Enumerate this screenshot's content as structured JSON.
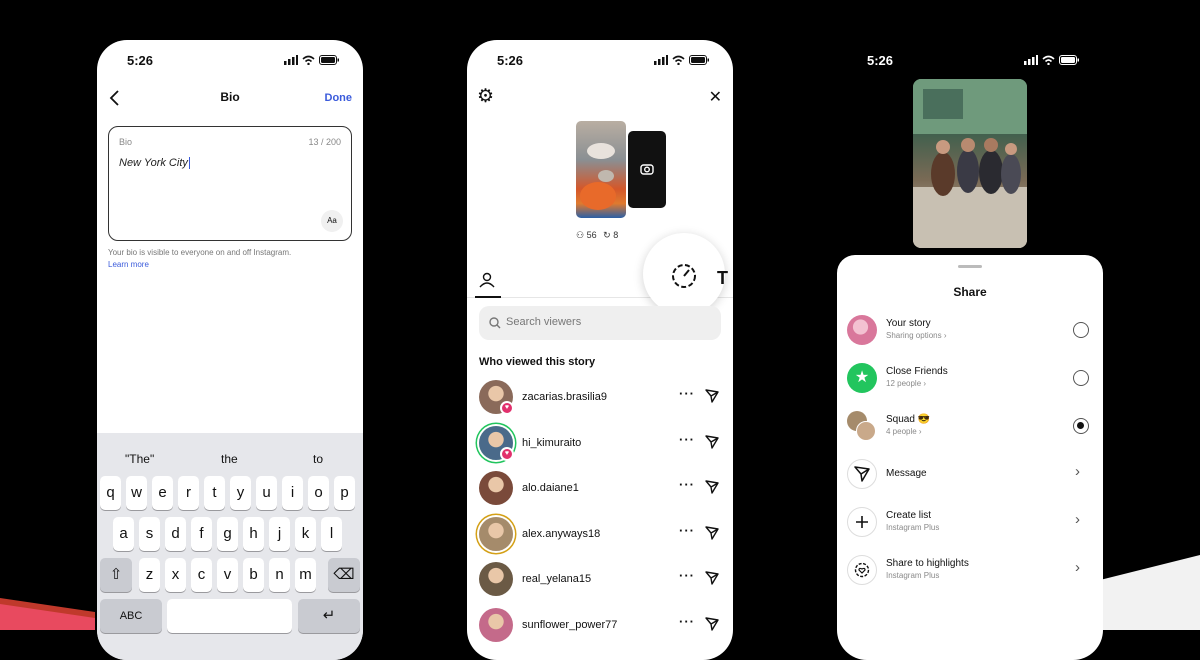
{
  "phone1": {
    "time": "5:26",
    "nav": {
      "title": "Bio",
      "done": "Done"
    },
    "bio_field": {
      "label": "Bio",
      "counter": "13 / 200",
      "value": "New York City",
      "format_button": "Aa"
    },
    "helper_text": "Your bio is visible to everyone on and off Instagram.",
    "learn_more": "Learn more",
    "keyboard": {
      "suggestions": [
        "\"The\"",
        "the",
        "to"
      ],
      "row1": [
        "q",
        "w",
        "e",
        "r",
        "t",
        "y",
        "u",
        "i",
        "o",
        "p"
      ],
      "row2": [
        "a",
        "s",
        "d",
        "f",
        "g",
        "h",
        "j",
        "k",
        "l"
      ],
      "row3": [
        "z",
        "x",
        "c",
        "v",
        "b",
        "n",
        "m"
      ],
      "abc": "ABC",
      "shift_glyph": "⇧",
      "delete_glyph": "⌫",
      "return_glyph": "↵"
    }
  },
  "phone2": {
    "time": "5:26",
    "gear_glyph": "⚙",
    "close_glyph": "✕",
    "stats": {
      "viewers": "56",
      "replays": "8"
    },
    "search_placeholder": "Search viewers",
    "section_title": "Who viewed this story",
    "viewers": [
      {
        "name": "zacarias.brasilia9",
        "liked": true,
        "color": "#8a6a5a"
      },
      {
        "name": "hi_kimuraito",
        "liked": true,
        "color": "#4a6a8a"
      },
      {
        "name": "alo.daiane1",
        "liked": false,
        "color": "#7a4a3a"
      },
      {
        "name": "alex.anyways18",
        "liked": false,
        "color": "#a58b6b"
      },
      {
        "name": "real_yelana15",
        "liked": false,
        "color": "#6b5a45"
      },
      {
        "name": "sunflower_power77",
        "liked": false,
        "color": "#c46a8a"
      }
    ]
  },
  "phone3": {
    "time": "5:26",
    "sheet_title": "Share",
    "rows": [
      {
        "title": "Your story",
        "subtitle": "Sharing options ›",
        "control": "radio",
        "selected": false,
        "color": "#d9779b"
      },
      {
        "title": "Close Friends",
        "subtitle": "12 people ›",
        "control": "radio",
        "selected": false,
        "color": "#22c55e"
      },
      {
        "title": "Squad 😎",
        "subtitle": "4 people ›",
        "control": "radio",
        "selected": true,
        "color": "#a58b6b"
      },
      {
        "title": "Message",
        "subtitle": "",
        "control": "chevron",
        "selected": false,
        "color": "#ffffff"
      },
      {
        "title": "Create list",
        "subtitle": "Instagram Plus",
        "control": "chevron",
        "selected": false,
        "color": "#ffffff"
      },
      {
        "title": "Share to highlights",
        "subtitle": "Instagram Plus",
        "control": "chevron",
        "selected": false,
        "color": "#ffffff"
      }
    ]
  },
  "colors": {
    "accent": "#3b5bdb",
    "close_friends": "#22c55e",
    "like": "#e1306c"
  }
}
